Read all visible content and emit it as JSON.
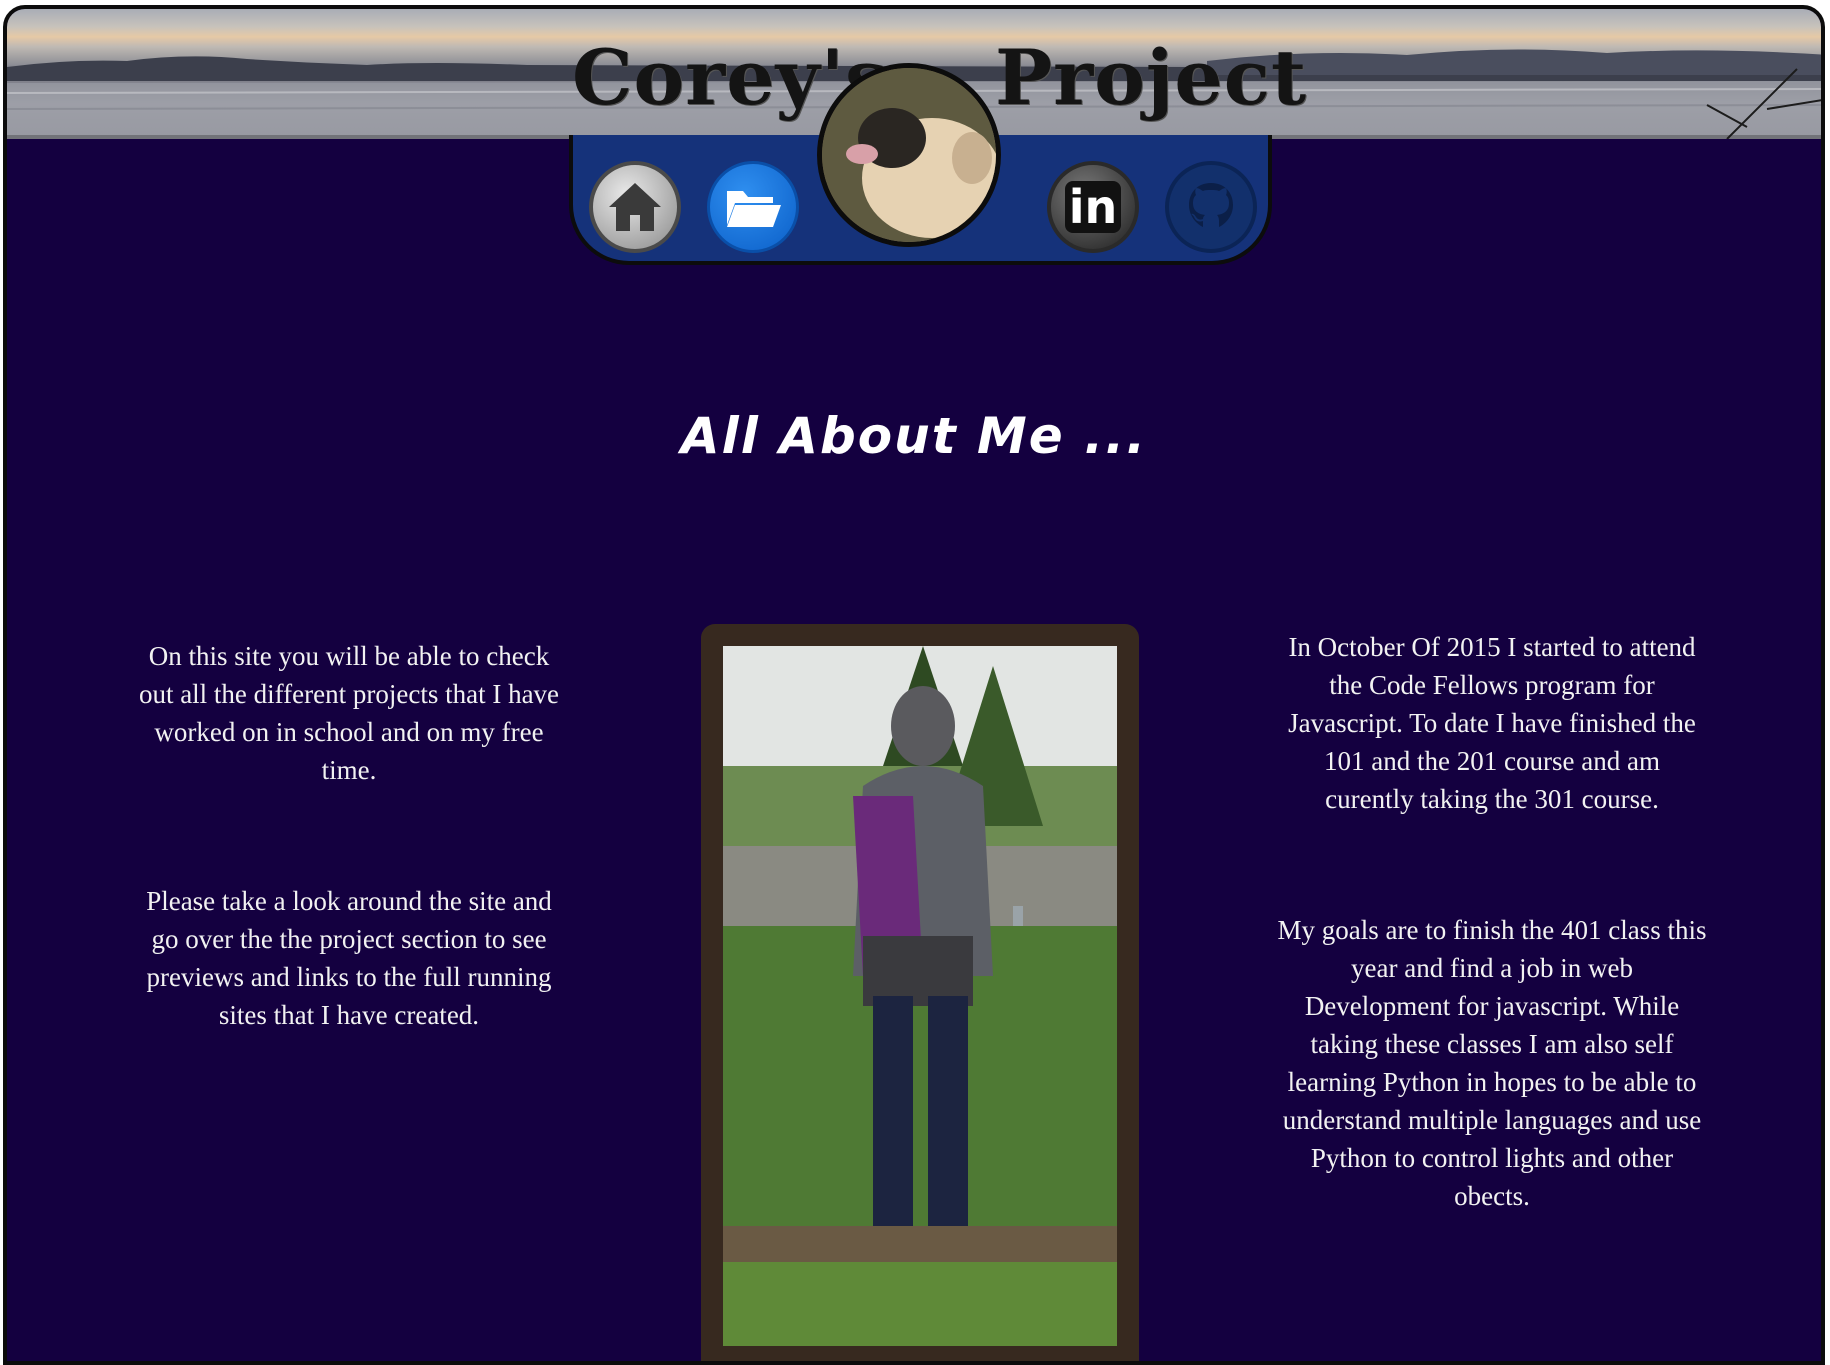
{
  "header": {
    "title_left": "Corey's",
    "title_right": "Project"
  },
  "nav": {
    "items": [
      {
        "name": "home",
        "icon": "home-icon"
      },
      {
        "name": "projects",
        "icon": "folder-icon"
      },
      {
        "name": "linkedin",
        "icon": "linkedin-icon",
        "text": "in"
      },
      {
        "name": "github",
        "icon": "github-icon"
      }
    ]
  },
  "main": {
    "heading": "All About Me ...",
    "left_paragraphs": [
      "On this site you will be able to check out all the different projects that I have worked on in school and on my free time.",
      "Please take a look around the site and go over the the project section to see previews and links to the full running sites that I have created."
    ],
    "right_paragraphs": [
      "In October Of 2015 I started to attend the Code Fellows program for Javascript. To date I have finished the 101 and the 201 course and am curently taking the 301 course.",
      "My goals are to finish the 401 class this year and find a job in web Development for javascript. While taking these classes I am also self learning Python in hopes to be able to understand multiple languages and use Python to control lights and other obects."
    ]
  },
  "colors": {
    "page_bg": "#140040",
    "navbar_bg": "#15327a",
    "frame": "#37291f",
    "text": "#ffffff"
  }
}
